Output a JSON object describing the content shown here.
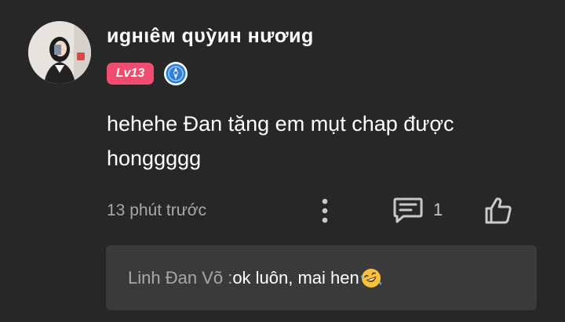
{
  "comment": {
    "username": "иgнιêм qυỳин нươиg",
    "level_badge": "Lv13",
    "body": "hehehe Đan tặng em mụt chap được honggggg",
    "timestamp": "13 phút trước",
    "reply_count": "1",
    "icons": {
      "avatar": "user-avatar",
      "rank": "blue-rank-badge-icon",
      "more": "vertical-dots-icon",
      "reply": "comment-bubble-icon",
      "like": "thumbs-up-icon",
      "emoji": "rolling-laughing-emoji"
    },
    "colors": {
      "background": "#272727",
      "level_badge": "#ef4c70",
      "rank_badge": "#2f7fe0",
      "muted_text": "#a8a8a8",
      "reply_box": "#3a3a3a"
    }
  },
  "reply_preview": {
    "author": "Linh Đan Võ :",
    "text": " ok luôn, mai hen"
  }
}
